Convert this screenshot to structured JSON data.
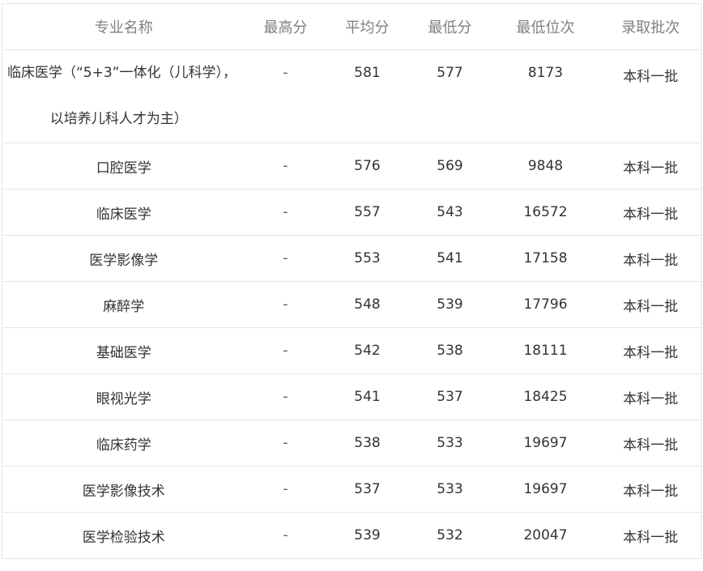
{
  "table": {
    "headers": [
      "专业名称",
      "最高分",
      "平均分",
      "最低分",
      "最低位次",
      "录取批次"
    ],
    "first_row": {
      "name_line1": "临床医学（“5+3”一体化（儿科学），",
      "name_line2": "以培养儿科人才为主）",
      "max": "-",
      "avg": "581",
      "min": "577",
      "rank": "8173",
      "batch": "本科一批"
    },
    "rows": [
      {
        "name": "口腔医学",
        "max": "-",
        "avg": "576",
        "min": "569",
        "rank": "9848",
        "batch": "本科一批"
      },
      {
        "name": "临床医学",
        "max": "-",
        "avg": "557",
        "min": "543",
        "rank": "16572",
        "batch": "本科一批"
      },
      {
        "name": "医学影像学",
        "max": "-",
        "avg": "553",
        "min": "541",
        "rank": "17158",
        "batch": "本科一批"
      },
      {
        "name": "麻醉学",
        "max": "-",
        "avg": "548",
        "min": "539",
        "rank": "17796",
        "batch": "本科一批"
      },
      {
        "name": "基础医学",
        "max": "-",
        "avg": "542",
        "min": "538",
        "rank": "18111",
        "batch": "本科一批"
      },
      {
        "name": "眼视光学",
        "max": "-",
        "avg": "541",
        "min": "537",
        "rank": "18425",
        "batch": "本科一批"
      },
      {
        "name": "临床药学",
        "max": "-",
        "avg": "538",
        "min": "533",
        "rank": "19697",
        "batch": "本科一批"
      },
      {
        "name": "医学影像技术",
        "max": "-",
        "avg": "537",
        "min": "533",
        "rank": "19697",
        "batch": "本科一批"
      },
      {
        "name": "医学检验技术",
        "max": "-",
        "avg": "539",
        "min": "532",
        "rank": "20047",
        "batch": "本科一批"
      }
    ]
  }
}
